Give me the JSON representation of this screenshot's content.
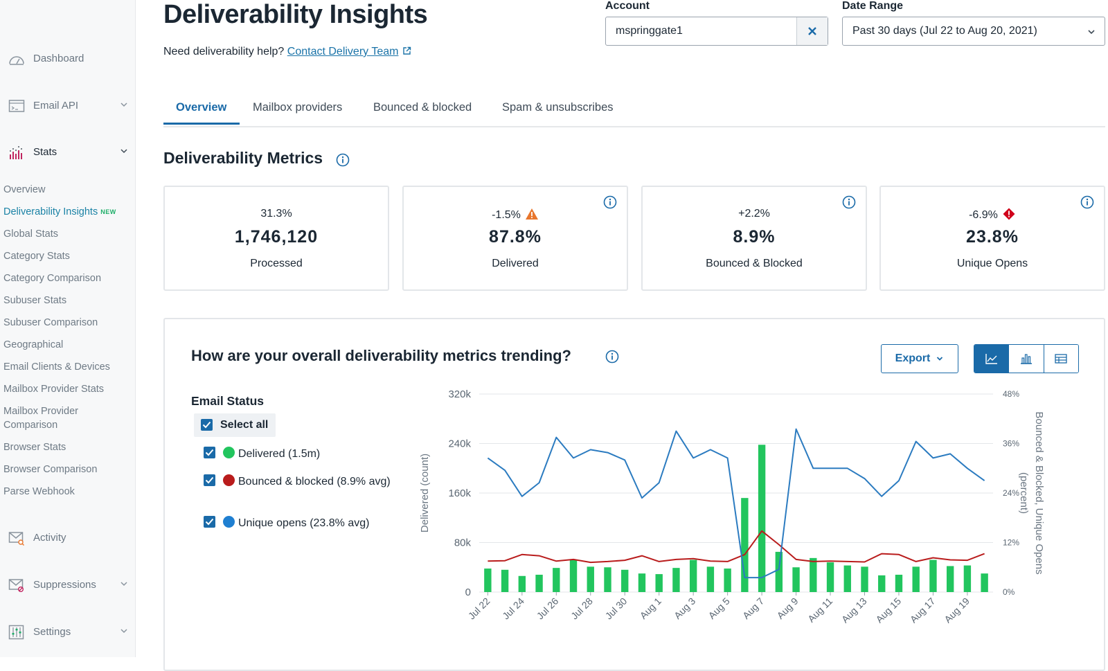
{
  "sidebar": {
    "top_items": [
      {
        "label": "Dashboard",
        "icon": "gauge-icon",
        "chevron": false
      },
      {
        "label": "Email API",
        "icon": "terminal-icon",
        "chevron": true
      },
      {
        "label": "Stats",
        "icon": "bar-chart-icon",
        "chevron": true
      }
    ],
    "stats_items": [
      {
        "label": "Overview"
      },
      {
        "label": "Deliverability Insights",
        "badge": "NEW",
        "active": true
      },
      {
        "label": "Global Stats"
      },
      {
        "label": "Category Stats"
      },
      {
        "label": "Category Comparison"
      },
      {
        "label": "Subuser Stats"
      },
      {
        "label": "Subuser Comparison"
      },
      {
        "label": "Geographical"
      },
      {
        "label": "Email Clients & Devices"
      },
      {
        "label": "Mailbox Provider Stats"
      },
      {
        "label": "Mailbox Provider Comparison"
      },
      {
        "label": "Browser Stats"
      },
      {
        "label": "Browser Comparison"
      },
      {
        "label": "Parse Webhook"
      }
    ],
    "bottom_items": [
      {
        "label": "Activity",
        "icon": "envelope-search-icon",
        "chevron": false
      },
      {
        "label": "Suppressions",
        "icon": "envelope-block-icon",
        "chevron": true
      },
      {
        "label": "Settings",
        "icon": "sliders-icon",
        "chevron": true
      }
    ]
  },
  "header": {
    "title": "Deliverability Insights",
    "help_text": "Need deliverability help?",
    "help_link": "Contact Delivery Team"
  },
  "account": {
    "label": "Account",
    "value": "mspringgate1"
  },
  "date_range": {
    "label": "Date Range",
    "value": "Past 30 days (Jul 22 to Aug 20, 2021)"
  },
  "tabs": [
    "Overview",
    "Mailbox providers",
    "Bounced & blocked",
    "Spam & unsubscribes"
  ],
  "metrics": {
    "title": "Deliverability Metrics",
    "cards": [
      {
        "delta": "31.3%",
        "value": "1,746,120",
        "label": "Processed",
        "status": "none"
      },
      {
        "delta": "-1.5%",
        "value": "87.8%",
        "label": "Delivered",
        "status": "warning"
      },
      {
        "delta": "+2.2%",
        "value": "8.9%",
        "label": "Bounced & Blocked",
        "status": "none"
      },
      {
        "delta": "-6.9%",
        "value": "23.8%",
        "label": "Unique Opens",
        "status": "alert"
      }
    ]
  },
  "trend": {
    "title": "How are your overall deliverability metrics trending?",
    "export_label": "Export",
    "status_title": "Email Status",
    "select_all": "Select all",
    "legend": [
      {
        "label": "Delivered (1.5m)",
        "color": "#22c55e"
      },
      {
        "label": "Bounced & blocked (8.9% avg)",
        "color": "#b91c1c"
      },
      {
        "label": "Unique opens (23.8% avg)",
        "color": "#1f7fd1"
      }
    ]
  },
  "colors": {
    "accent": "#1a6aa8",
    "warning": "#e8762d",
    "alert": "#d0021b",
    "delivered": "#22c55e",
    "bounced": "#b91c1c",
    "opens": "#2b7bc0"
  },
  "chart_data": {
    "type": "bar+line",
    "x": [
      "Jul 22",
      "Jul 23",
      "Jul 24",
      "Jul 25",
      "Jul 26",
      "Jul 27",
      "Jul 28",
      "Jul 29",
      "Jul 30",
      "Jul 31",
      "Aug 1",
      "Aug 2",
      "Aug 3",
      "Aug 4",
      "Aug 5",
      "Aug 6",
      "Aug 7",
      "Aug 8",
      "Aug 9",
      "Aug 10",
      "Aug 11",
      "Aug 12",
      "Aug 13",
      "Aug 14",
      "Aug 15",
      "Aug 16",
      "Aug 17",
      "Aug 18",
      "Aug 19",
      "Aug 20"
    ],
    "x_tick_labels": [
      "Jul 22",
      "Jul 24",
      "Jul 26",
      "Jul 28",
      "Jul 30",
      "Aug 1",
      "Aug 3",
      "Aug 5",
      "Aug 7",
      "Aug 9",
      "Aug 11",
      "Aug 13",
      "Aug 15",
      "Aug 17",
      "Aug 19"
    ],
    "y_left": {
      "label": "Delivered (count)",
      "ticks": [
        "0",
        "80k",
        "160k",
        "240k",
        "320k"
      ],
      "range": [
        0,
        320000
      ]
    },
    "y_right": {
      "label": "Bounced & Blocked, Unique Opens (percent)",
      "ticks": [
        "0%",
        "12%",
        "24%",
        "36%",
        "48%"
      ],
      "range": [
        0,
        48
      ]
    },
    "series": [
      {
        "name": "Delivered",
        "axis": "left",
        "kind": "bar",
        "values": [
          38000,
          36000,
          26000,
          28000,
          39000,
          52000,
          41000,
          40000,
          36000,
          30000,
          29000,
          39000,
          52000,
          41000,
          38000,
          152000,
          238000,
          65000,
          40000,
          55000,
          48000,
          43000,
          41000,
          27000,
          28000,
          41000,
          52000,
          42000,
          43000,
          30000
        ]
      },
      {
        "name": "Bounced & blocked",
        "axis": "right",
        "kind": "line",
        "values": [
          7.5,
          7.6,
          9.1,
          8.8,
          7.5,
          7.9,
          7.2,
          7.4,
          7.7,
          8.8,
          7.4,
          7.9,
          8.1,
          7.5,
          7.4,
          9.1,
          14.8,
          11.5,
          7.9,
          7.4,
          7.5,
          7.4,
          7.3,
          9.3,
          9.1,
          7.4,
          8.3,
          7.8,
          7.7,
          9.3
        ]
      },
      {
        "name": "Unique opens",
        "axis": "right",
        "kind": "line",
        "values": [
          32.5,
          29.5,
          23.2,
          26.5,
          37.5,
          32.5,
          34.5,
          33.8,
          32.0,
          22.8,
          26.5,
          39.0,
          32.5,
          34.5,
          32.5,
          3.5,
          3.5,
          5.5,
          39.5,
          30.0,
          30.0,
          30.0,
          27.5,
          23.2,
          27.0,
          36.5,
          32.5,
          33.5,
          30.0,
          27.0
        ]
      }
    ]
  }
}
